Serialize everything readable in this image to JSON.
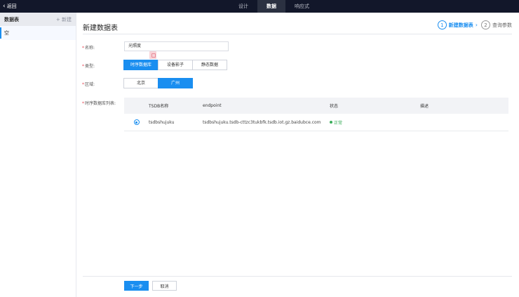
{
  "topbar": {
    "back_label": "返回",
    "tabs": [
      {
        "label": "设计"
      },
      {
        "label": "数据"
      },
      {
        "label": "响应式"
      }
    ]
  },
  "sidebar": {
    "title": "数据表",
    "new_label": "+ 新建",
    "items": [
      {
        "label": "空"
      }
    ]
  },
  "page": {
    "title": "新建数据表",
    "steps": [
      {
        "num": "1",
        "label": "新建数据表"
      },
      {
        "num": "2",
        "label": "查询参数"
      }
    ]
  },
  "form": {
    "name_label": "名称:",
    "name_value": "光照度",
    "type_label": "类型:",
    "type_options": [
      "时序数据库",
      "设备影子",
      "静态数据"
    ],
    "type_selected": "时序数据库",
    "region_label": "区域:",
    "region_options": [
      "北京",
      "广州"
    ],
    "region_selected": "广州",
    "tsdb_list_label": "时序数据库列表:"
  },
  "table": {
    "headers": [
      "TSDB名称",
      "endpoint",
      "状态",
      "描述"
    ],
    "rows": [
      {
        "name": "tsdbshujuku",
        "endpoint": "tsdbshujuku.tsdb-cttzc3tukbfk.tsdb.iot.gz.baidubce.com",
        "status": "正常",
        "desc": ""
      }
    ]
  },
  "footer": {
    "next_label": "下一步",
    "cancel_label": "取消"
  },
  "colors": {
    "accent": "#1a8ef0",
    "topbar_bg": "#12172a",
    "status_ok": "#3cae5b",
    "required": "#e64552"
  }
}
